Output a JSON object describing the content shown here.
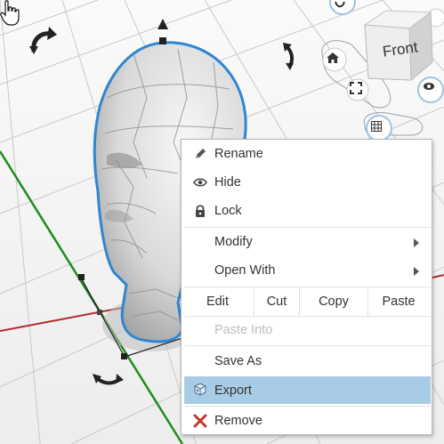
{
  "view": {
    "cube_face": "Front",
    "icons": [
      "rotate-left-icon",
      "up-arrow-icon",
      "rotate-right-icon",
      "home-icon",
      "fit-view-icon",
      "orbit-icon",
      "camera-icon",
      "grid-icon",
      "gizmo-rotate-icon"
    ]
  },
  "menu": {
    "rename": "Rename",
    "hide": "Hide",
    "lock": "Lock",
    "modify": "Modify",
    "open_with": "Open With",
    "edit": "Edit",
    "cut": "Cut",
    "copy": "Copy",
    "paste": "Paste",
    "paste_into": "Paste Into",
    "save_as": "Save As",
    "export": "Export",
    "remove": "Remove"
  },
  "colors": {
    "highlight": "#a9cce6",
    "selection_outline": "#2f86d1",
    "axis_green": "#1e8c1e",
    "axis_red": "#b52a2a",
    "remove_icon": "#c0392b"
  }
}
